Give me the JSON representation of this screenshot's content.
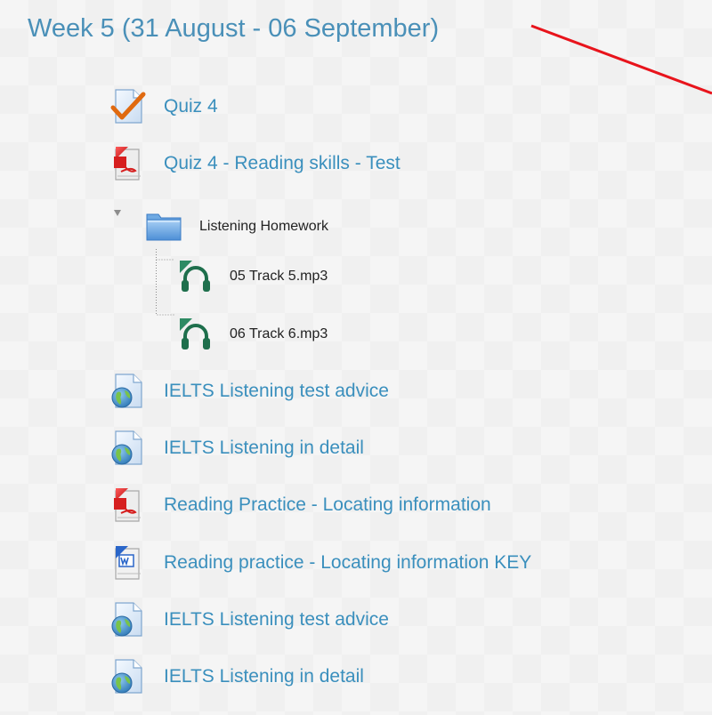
{
  "section": {
    "title": "Week 5 (31 August - 06 September)"
  },
  "activities": [
    {
      "label": "Quiz 4",
      "icon": "quiz-check-icon"
    },
    {
      "label": "Quiz 4 - Reading skills - Test",
      "icon": "pdf-icon"
    },
    {
      "label": "IELTS Listening test advice",
      "icon": "url-globe-icon"
    },
    {
      "label": "IELTS Listening in detail",
      "icon": "url-globe-icon"
    },
    {
      "label": "Reading Practice - Locating information",
      "icon": "pdf-icon"
    },
    {
      "label": "Reading practice - Locating information KEY",
      "icon": "word-document-icon"
    },
    {
      "label": "IELTS Listening test advice",
      "icon": "url-globe-icon"
    },
    {
      "label": "IELTS Listening in detail",
      "icon": "url-globe-icon"
    }
  ],
  "folder": {
    "label": "Listening Homework",
    "icon": "folder-icon",
    "files": [
      {
        "label": "05 Track 5.mp3",
        "icon": "audio-headphones-icon"
      },
      {
        "label": "06 Track 6.mp3",
        "icon": "audio-headphones-icon"
      }
    ]
  },
  "colors": {
    "link": "#3a8fbd",
    "title": "#4a90b8",
    "annotation_arrow": "#e8141c",
    "background": "#f5f5f5"
  }
}
